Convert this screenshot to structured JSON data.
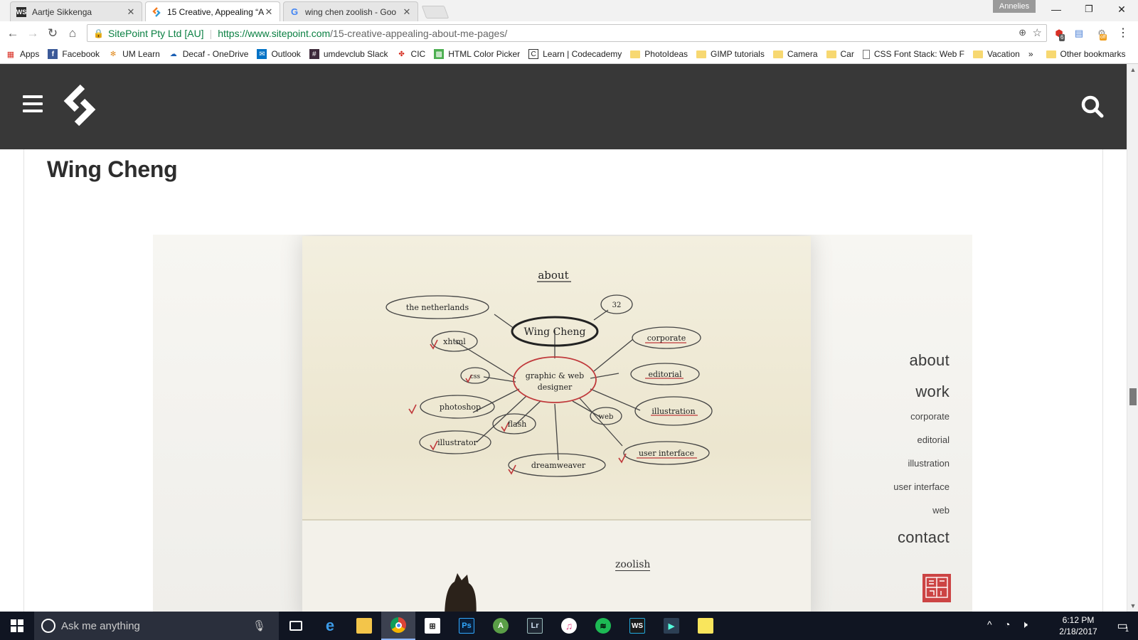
{
  "tabs": [
    {
      "title": "Aartje Sikkenga",
      "favicon": "WS"
    },
    {
      "title": "15 Creative, Appealing “A",
      "favicon": "sitepoint"
    },
    {
      "title": "wing chen zoolish - Goo",
      "favicon": "G"
    }
  ],
  "profile_name": "Annelies",
  "toolbar": {
    "site_identity": "SitePoint Pty Ltd [AU]",
    "url_host": "https://www.sitepoint.com",
    "url_path": "/15-creative-appealing-about-me-pages/",
    "extension_badge_1": "6",
    "extension_badge_2": "off"
  },
  "bookmarks": [
    {
      "label": "Apps",
      "icon": "apps-grid-icon"
    },
    {
      "label": "Facebook",
      "icon": "facebook-icon"
    },
    {
      "label": "UM Learn",
      "icon": "um-learn-icon"
    },
    {
      "label": "Decaf - OneDrive",
      "icon": "onedrive-icon"
    },
    {
      "label": "Outlook",
      "icon": "mail-icon"
    },
    {
      "label": "umdevclub Slack",
      "icon": "slack-icon"
    },
    {
      "label": "CIC",
      "icon": "maple-leaf-icon"
    },
    {
      "label": "HTML Color Picker",
      "icon": "color-picker-icon"
    },
    {
      "label": "Learn | Codecademy",
      "icon": "codecademy-icon"
    },
    {
      "label": "PhotoIdeas",
      "icon": "folder-icon"
    },
    {
      "label": "GIMP tutorials",
      "icon": "folder-icon"
    },
    {
      "label": "Camera",
      "icon": "folder-icon"
    },
    {
      "label": "Car",
      "icon": "folder-icon"
    },
    {
      "label": "CSS Font Stack: Web F",
      "icon": "page-icon"
    },
    {
      "label": "Vacation",
      "icon": "folder-icon"
    }
  ],
  "bookmarks_overflow": "»",
  "other_bookmarks": "Other bookmarks",
  "article": {
    "heading": "Wing Cheng"
  },
  "embedded_site": {
    "mindmap": {
      "title": "about",
      "center": "Wing Cheng",
      "hub": [
        "graphic & web",
        "designer"
      ],
      "nodes": [
        "the netherlands",
        "xhtml",
        "css",
        "photoshop",
        "illustrator",
        "flash",
        "dreamweaver",
        "web",
        "user interface",
        "illustration",
        "editorial",
        "corporate",
        "32"
      ],
      "footer": "zoolish"
    },
    "nav": {
      "about": "about",
      "work": "work",
      "items": [
        "corporate",
        "editorial",
        "illustration",
        "user interface",
        "web"
      ],
      "contact": "contact"
    }
  },
  "taskbar": {
    "search_placeholder": "Ask me anything",
    "time": "6:12 PM",
    "date": "2/18/2017",
    "notification_count": "1"
  },
  "colors": {
    "header_bg": "#383838",
    "secure_green": "#0b8043",
    "taskbar_bg": "#101522",
    "mindmap_red": "#c0393b"
  }
}
